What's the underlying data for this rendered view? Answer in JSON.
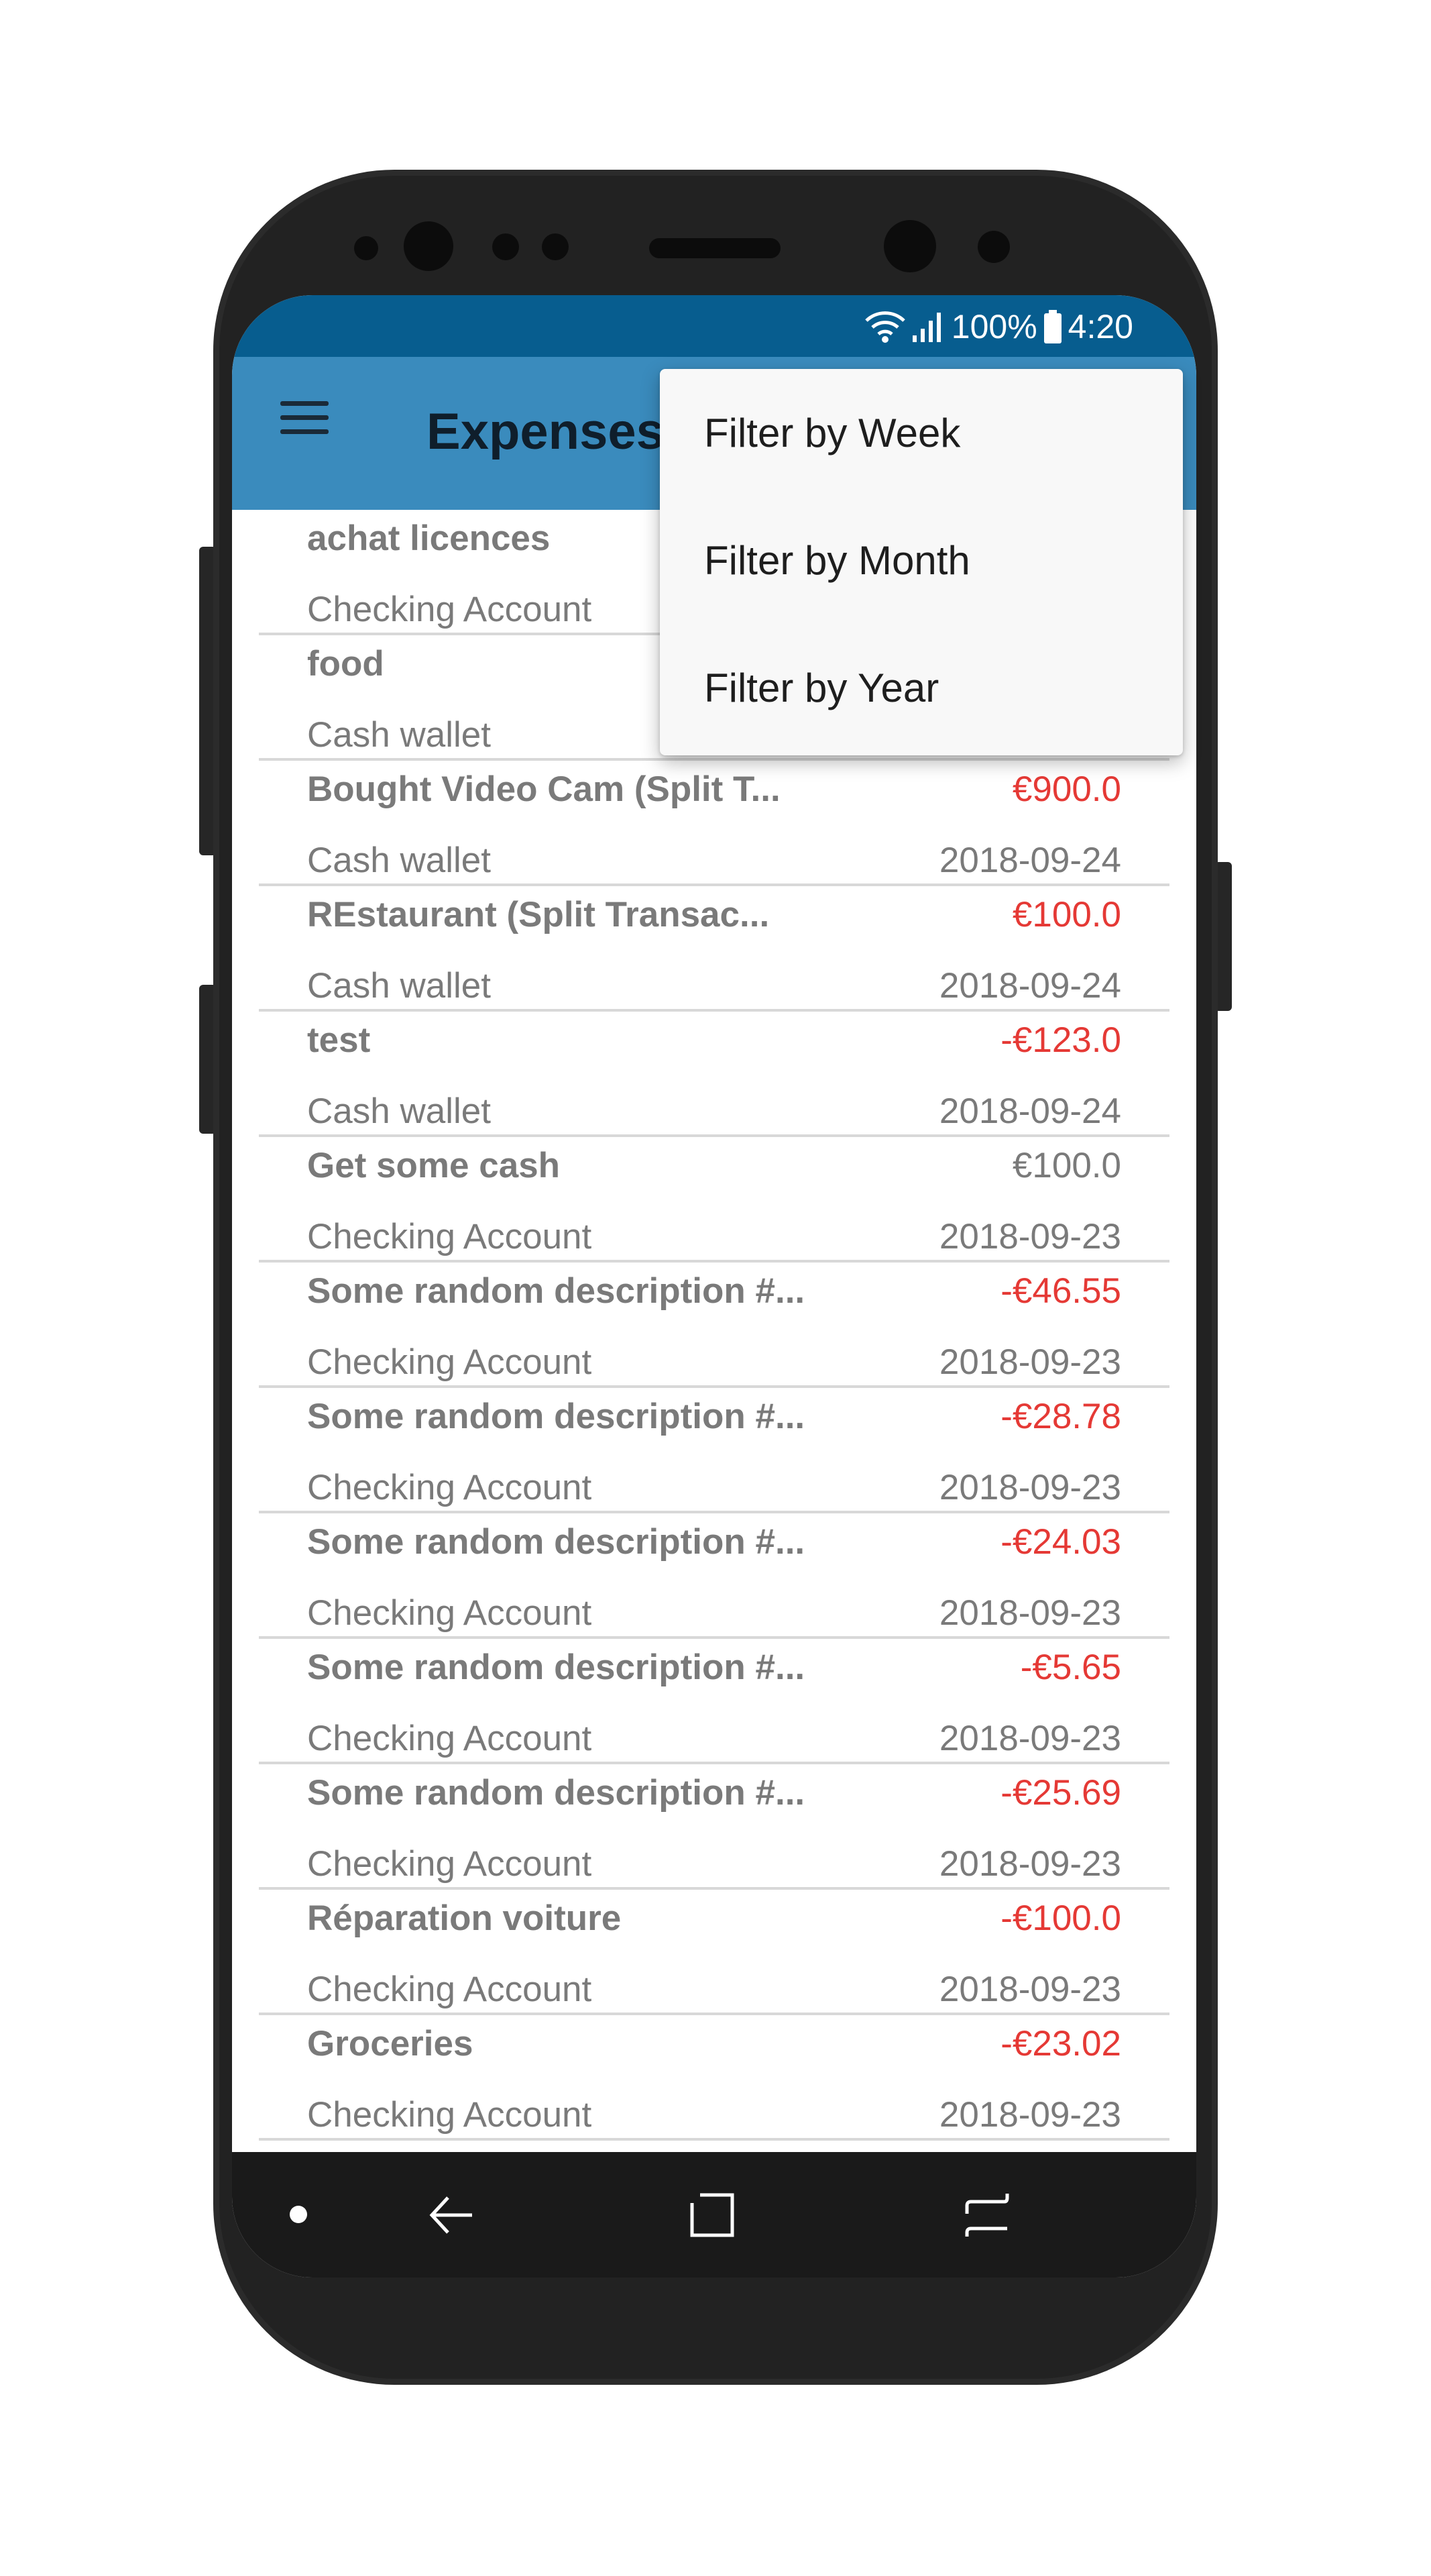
{
  "status_bar": {
    "battery": "100%",
    "time": "4:20",
    "icons": [
      "wifi-icon",
      "signal-icon",
      "battery-icon"
    ]
  },
  "app_bar": {
    "title": "Expenses",
    "menu_icon": "hamburger-menu-icon"
  },
  "filter_menu": {
    "items": [
      {
        "label": "Filter by Week"
      },
      {
        "label": "Filter by Month"
      },
      {
        "label": "Filter by Year"
      }
    ]
  },
  "transactions": [
    {
      "description": "achat licences",
      "amount": "",
      "account": "Checking Account",
      "date": ""
    },
    {
      "description": "food",
      "amount": "",
      "account": "Cash wallet",
      "date": ""
    },
    {
      "description": "Bought Video Cam (Split T...",
      "amount": "€900.0",
      "account": "Cash wallet",
      "date": "2018-09-24"
    },
    {
      "description": "REstaurant (Split Transac...",
      "amount": "€100.0",
      "account": "Cash wallet",
      "date": "2018-09-24"
    },
    {
      "description": "test",
      "amount": "-€123.0",
      "account": "Cash wallet",
      "date": "2018-09-24"
    },
    {
      "description": "Get some cash",
      "amount": "€100.0",
      "account": "Checking Account",
      "date": "2018-09-23"
    },
    {
      "description": "Some random description #...",
      "amount": "-€46.55",
      "account": "Checking Account",
      "date": "2018-09-23"
    },
    {
      "description": "Some random description #...",
      "amount": "-€28.78",
      "account": "Checking Account",
      "date": "2018-09-23"
    },
    {
      "description": "Some random description #...",
      "amount": "-€24.03",
      "account": "Checking Account",
      "date": "2018-09-23"
    },
    {
      "description": "Some random description #...",
      "amount": "-€5.65",
      "account": "Checking Account",
      "date": "2018-09-23"
    },
    {
      "description": "Some random description #...",
      "amount": "-€25.69",
      "account": "Checking Account",
      "date": "2018-09-23"
    },
    {
      "description": "Réparation voiture",
      "amount": "-€100.0",
      "account": "Checking Account",
      "date": "2018-09-23"
    },
    {
      "description": "Groceries",
      "amount": "-€23.02",
      "account": "Checking Account",
      "date": "2018-09-23"
    }
  ],
  "nav_bar": {
    "buttons": [
      "dot-icon",
      "back-icon",
      "home-icon",
      "recents-icon"
    ]
  },
  "colors": {
    "status_bar": "#075d8f",
    "app_bar": "#3a8bbd",
    "expense_red": "#e53935",
    "text_gray": "#7a7a7a",
    "phone_body": "#2b2b2b"
  }
}
